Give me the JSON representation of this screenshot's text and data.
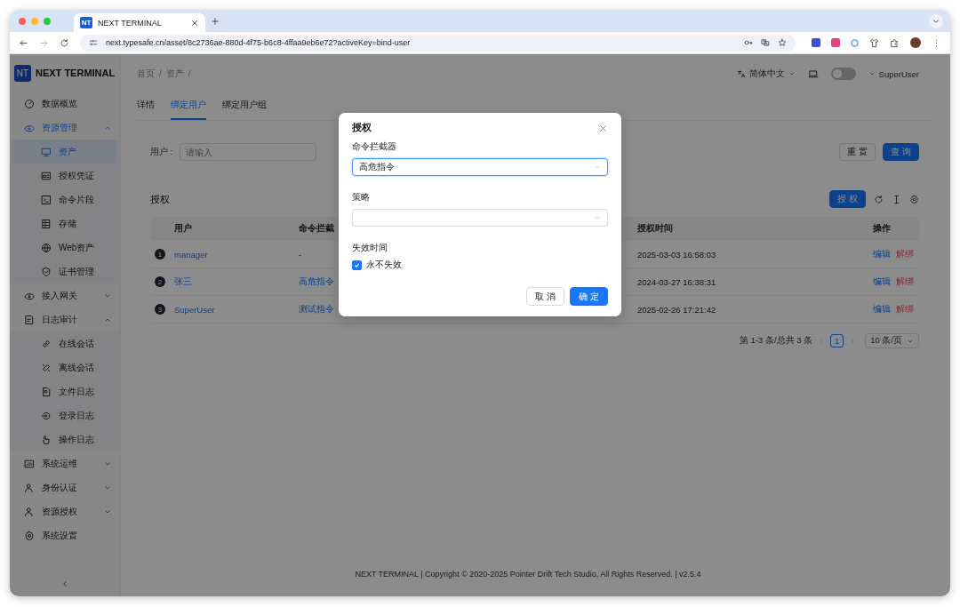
{
  "browser": {
    "favicon": "NT",
    "tab_title": "NEXT TERMINAL",
    "url": "next.typesafe.cn/asset/8c2736ae-880d-4f75-b6c8-4ffaa9eb6e72?activeKey=bind-user"
  },
  "logo": {
    "badge": "NT",
    "name": "NEXT TERMINAL"
  },
  "sidebar": {
    "items": [
      {
        "label": "数据概览",
        "selected": false
      },
      {
        "label": "资源管理",
        "selected": false,
        "expanded": true,
        "children": [
          {
            "label": "资产",
            "selected": true
          },
          {
            "label": "授权凭证",
            "selected": false
          },
          {
            "label": "命令片段",
            "selected": false
          },
          {
            "label": "存储",
            "selected": false
          },
          {
            "label": "Web资产",
            "selected": false
          },
          {
            "label": "证书管理",
            "selected": false
          }
        ]
      },
      {
        "label": "接入网关",
        "selected": false,
        "expanded": false
      },
      {
        "label": "日志审计",
        "selected": false,
        "expanded": true,
        "children": [
          {
            "label": "在线会话",
            "selected": false
          },
          {
            "label": "离线会话",
            "selected": false
          },
          {
            "label": "文件日志",
            "selected": false
          },
          {
            "label": "登录日志",
            "selected": false
          },
          {
            "label": "操作日志",
            "selected": false
          }
        ]
      },
      {
        "label": "系统运维",
        "selected": false,
        "expanded": false
      },
      {
        "label": "身份认证",
        "selected": false,
        "expanded": false
      },
      {
        "label": "资源授权",
        "selected": false,
        "expanded": false
      },
      {
        "label": "系统设置",
        "selected": false
      }
    ]
  },
  "header": {
    "breadcrumb": [
      {
        "label": "首页",
        "separator": "/"
      },
      {
        "label": "资产",
        "separator": "/"
      }
    ],
    "language": "简体中文",
    "dark_mode": false,
    "user": "SuperUser"
  },
  "tabs": [
    {
      "label": "详情",
      "selected": false
    },
    {
      "label": "绑定用户",
      "selected": true
    },
    {
      "label": "绑定用户组",
      "selected": false
    }
  ],
  "search": {
    "label": "用户 :",
    "placeholder": "请输入",
    "buttons": [
      {
        "label": "重 置",
        "kind": "default"
      },
      {
        "label": "查 询",
        "kind": "primary"
      }
    ]
  },
  "table": {
    "title": "授权",
    "button": "授 权",
    "columns": [
      "用户",
      "命令拦截",
      "授权时间",
      "操作"
    ],
    "rows": [
      {
        "index": "1",
        "user": "manager",
        "interceptor": {
          "text": "-",
          "kind": "plain"
        },
        "time": "2025-03-03 16:58:03",
        "actions": [
          {
            "label": "编辑",
            "kind": "edit"
          },
          {
            "label": "解绑",
            "kind": "danger"
          }
        ]
      },
      {
        "index": "2",
        "user": "张三",
        "interceptor": {
          "text": "高危指令",
          "kind": "link"
        },
        "time": "2024-03-27 16:38:31",
        "actions": [
          {
            "label": "编辑",
            "kind": "edit"
          },
          {
            "label": "解绑",
            "kind": "danger"
          }
        ]
      },
      {
        "index": "3",
        "user": "SuperUser",
        "interceptor": {
          "text": "测试指令",
          "kind": "link"
        },
        "time": "2025-02-26 17:21:42",
        "actions": [
          {
            "label": "编辑",
            "kind": "edit"
          },
          {
            "label": "解绑",
            "kind": "danger"
          }
        ]
      }
    ]
  },
  "pagination": {
    "summary": "第 1-3 条/总共 3 条",
    "pages": [
      {
        "label": "1",
        "selected": true
      }
    ],
    "page_size": "10 条/页"
  },
  "footer": "NEXT TERMINAL | Copyright © 2020-2025 Pointer Drift Tech Studio, All Rights Reserved. | v2.5.4",
  "modal": {
    "title": "授权",
    "fields": [
      {
        "label": "命令拦截器",
        "value": "高危指令",
        "focused": true
      },
      {
        "label": "策略",
        "focused": false
      }
    ],
    "expiry": {
      "label": "失效时间",
      "option": "永不失效",
      "checked": true
    },
    "buttons": [
      {
        "label": "取 消",
        "kind": "default"
      },
      {
        "label": "确 定",
        "kind": "primary"
      }
    ]
  }
}
